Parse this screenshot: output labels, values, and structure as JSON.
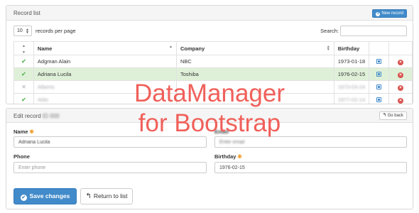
{
  "list_panel": {
    "title": "Record list",
    "new_button": "New record",
    "per_page_value": "10",
    "per_page_label": "records per page",
    "search_label": "Search:",
    "search_value": "",
    "columns": {
      "check": "",
      "name": "Name",
      "company": "Company",
      "birthday": "Birthday"
    },
    "rows": [
      {
        "name": "Adgman Alain",
        "company": "NBC",
        "birthday": "1973-01-18",
        "checked": true
      },
      {
        "name": "Adriana Lucila",
        "company": "Toshiba",
        "birthday": "1976-02-15",
        "checked": true
      },
      {
        "name": "Alberto",
        "company": "",
        "birthday": "1973-03-24",
        "checked": false
      },
      {
        "name": "Aldo",
        "company": "",
        "birthday": "1977-02-14",
        "checked": true
      }
    ]
  },
  "edit_panel": {
    "title": "Edit record",
    "title_suffix": "ID 000",
    "back_button": "Go back",
    "fields": {
      "name": {
        "label": "Name",
        "value": "Adriana Lucila"
      },
      "email": {
        "label": "Email",
        "placeholder": "Enter email"
      },
      "phone": {
        "label": "Phone",
        "placeholder": "Enter phone"
      },
      "birthday": {
        "label": "Birthday",
        "value": "1976-02-15"
      }
    },
    "save_button": "Save changes",
    "return_button": "Return to list"
  },
  "watermark": {
    "line1": "DataManager",
    "line2": "for Bootstrap"
  },
  "colors": {
    "primary": "#428bca",
    "selected_row": "#dff0d8",
    "check": "#5cb85c",
    "delete": "#d9534f",
    "required": "#f0a030",
    "watermark": "#f0605a"
  },
  "icons": {
    "new": "plus-circle-icon",
    "check": "checkmark-icon",
    "uncheck": "cross-icon",
    "edit": "edit-icon",
    "delete": "delete-icon",
    "back": "arrow-left-icon",
    "save": "ok-circle-icon"
  }
}
